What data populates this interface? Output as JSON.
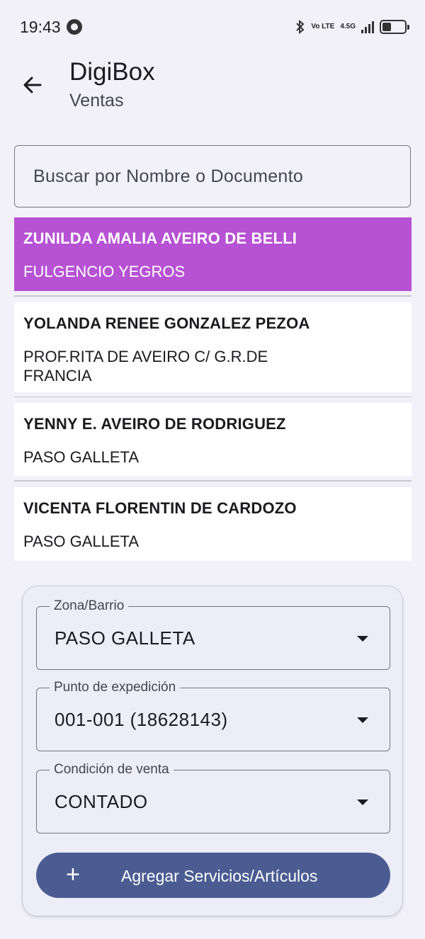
{
  "status_bar": {
    "time": "19:43",
    "network_top": "Vo LTE",
    "network_gen": "4.5G",
    "icons": [
      "chrome-icon",
      "bluetooth-icon",
      "signal-icon",
      "battery-icon"
    ]
  },
  "app_bar": {
    "title": "DigiBox",
    "subtitle": "Ventas",
    "back_icon": "arrow-left-icon"
  },
  "search": {
    "placeholder": "Buscar por Nombre o Documento"
  },
  "clients": [
    {
      "name": "ZUNILDA AMALIA AVEIRO DE BELLI",
      "address": "FULGENCIO YEGROS",
      "selected": true
    },
    {
      "name": "YOLANDA RENEE GONZALEZ PEZOA",
      "address": "PROF.RITA DE AVEIRO C/ G.R.DE FRANCIA",
      "selected": false
    },
    {
      "name": "YENNY E. AVEIRO DE RODRIGUEZ",
      "address": "PASO GALLETA",
      "selected": false
    },
    {
      "name": "VICENTA FLORENTIN DE CARDOZO",
      "address": "PASO GALLETA",
      "selected": false
    }
  ],
  "form": {
    "zona": {
      "label": "Zona/Barrio",
      "value": "PASO GALLETA"
    },
    "punto": {
      "label": "Punto de expedición",
      "value": "001-001 (18628143)"
    },
    "condicion": {
      "label": "Condición de venta",
      "value": "CONTADO"
    },
    "add_button": {
      "label": "Agregar Servicios/Artículos",
      "icon": "plus-icon"
    }
  },
  "colors": {
    "selected_row": "#b752d4",
    "primary_button": "#4b5c92",
    "background": "#f2f1f9"
  }
}
